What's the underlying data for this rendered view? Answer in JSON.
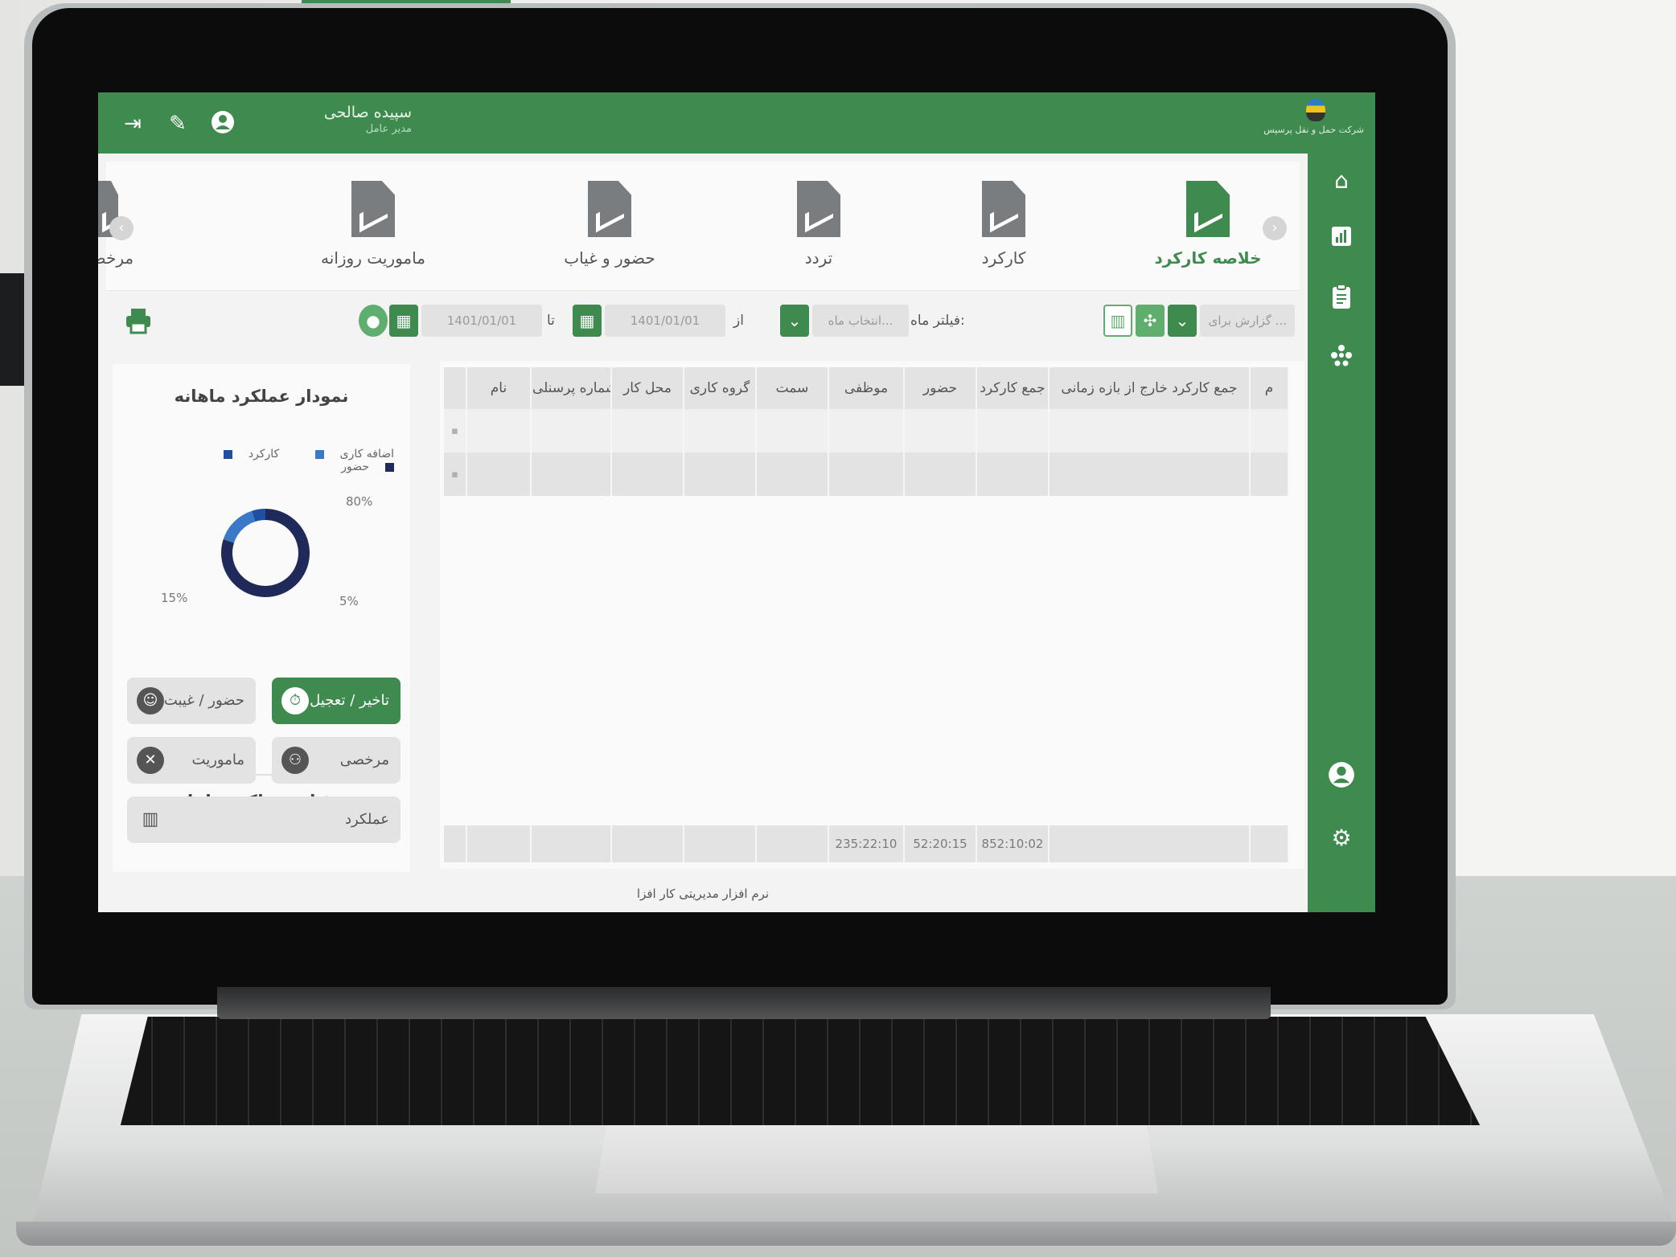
{
  "header": {
    "user_name": "سپیده صالحی",
    "user_role": "مدیر عامل",
    "brand_text": "شرکت حمل و نقل پرسپس"
  },
  "modules": [
    {
      "label": "خلاصه کارکرد",
      "icon": "chart-document-icon",
      "active": true
    },
    {
      "label": "کارکرد",
      "icon": "document-chart-icon",
      "active": false
    },
    {
      "label": "تردد",
      "icon": "document-arrow-icon",
      "active": false
    },
    {
      "label": "حضور و غیاب",
      "icon": "document-add-icon",
      "active": false
    },
    {
      "label": "ماموریت روزانه",
      "icon": "document-pie-icon",
      "active": false
    },
    {
      "label": "مرخصی",
      "icon": "document-leave-icon",
      "active": false
    }
  ],
  "filters": {
    "report_for_placeholder": "گزارش برای ...",
    "month_filter_label": "فیلتر ماه:",
    "month_placeholder": "انتخاب ماه...",
    "from_label": "از",
    "from_date": "1401/01/01",
    "to_label": "تا",
    "to_date": "1401/01/01"
  },
  "table": {
    "headers": [
      "نام",
      "شماره پرسنلی",
      "محل کار",
      "گروه کاری",
      "سمت",
      "موظفی",
      "حضور",
      "جمع کارکرد",
      "جمع کارکرد خارج از بازه زمانی",
      "م"
    ],
    "footer_values": [
      "235:22:10",
      "52:20:15",
      "852:10:02"
    ]
  },
  "chart_data": {
    "type": "pie",
    "title": "نمودار عملکرد ماهانه",
    "legend": [
      {
        "name": "حضور",
        "color": "#1f2a5a"
      },
      {
        "name": "کارکرد",
        "color": "#1e4fa0"
      },
      {
        "name": "اضافه کاری",
        "color": "#3a78c8"
      }
    ],
    "slices": [
      {
        "name": "حضور",
        "value": 80,
        "label": "80%"
      },
      {
        "name": "اضافه کاری",
        "value": 15,
        "label": "15%"
      },
      {
        "name": "کارکرد",
        "value": 5,
        "label": "5%"
      }
    ]
  },
  "details": {
    "title": "جزئیات عملکرد ماهانه",
    "buttons": {
      "delay": "تاخیر / تعجیل",
      "presence": "حضور / غیبت",
      "leave": "مرخصی",
      "mission": "ماموریت",
      "performance": "عملکرد"
    }
  },
  "footer": "نرم افزار مدیریتی کار افزا",
  "colors": {
    "primary": "#3f8a4e",
    "panel": "#f3f3f3"
  }
}
